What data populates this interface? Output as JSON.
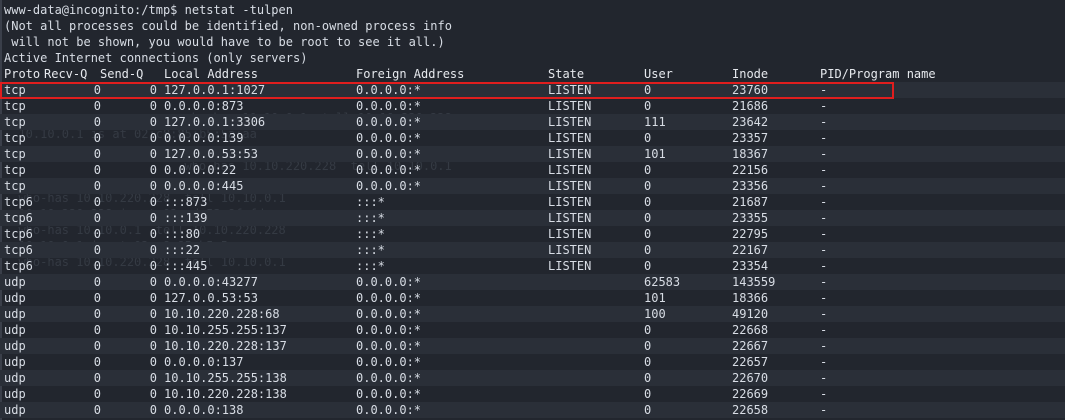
{
  "terminal": {
    "prompt": "www-data@incognito:/tmp$ netstat -tulpen",
    "notice_line1": "(Not all processes could be identified, non-owned process info",
    "notice_line2": " will not be shown, you would have to be root to see it all.)",
    "active_line": "Active Internet connections (only servers)"
  },
  "columns": {
    "proto": "Proto",
    "recvq": "Recv-Q",
    "sendq": "Send-Q",
    "local": "Local Address",
    "foreign": "Foreign Address",
    "state": "State",
    "user": "User",
    "inode": "Inode",
    "pid": "PID/Program name"
  },
  "rows": [
    {
      "proto": "tcp",
      "recvq": "0",
      "sendq": "0",
      "local": "127.0.0.1:1027",
      "foreign": "0.0.0.0:*",
      "state": "LISTEN",
      "user": "0",
      "inode": "23760",
      "pid": "-"
    },
    {
      "proto": "tcp",
      "recvq": "0",
      "sendq": "0",
      "local": "0.0.0.0:873",
      "foreign": "0.0.0.0:*",
      "state": "LISTEN",
      "user": "0",
      "inode": "21686",
      "pid": "-"
    },
    {
      "proto": "tcp",
      "recvq": "0",
      "sendq": "0",
      "local": "127.0.0.1:3306",
      "foreign": "0.0.0.0:*",
      "state": "LISTEN",
      "user": "111",
      "inode": "23642",
      "pid": "-"
    },
    {
      "proto": "tcp",
      "recvq": "0",
      "sendq": "0",
      "local": "0.0.0.0:139",
      "foreign": "0.0.0.0:*",
      "state": "LISTEN",
      "user": "0",
      "inode": "23357",
      "pid": "-"
    },
    {
      "proto": "tcp",
      "recvq": "0",
      "sendq": "0",
      "local": "127.0.0.53:53",
      "foreign": "0.0.0.0:*",
      "state": "LISTEN",
      "user": "101",
      "inode": "18367",
      "pid": "-"
    },
    {
      "proto": "tcp",
      "recvq": "0",
      "sendq": "0",
      "local": "0.0.0.0:22",
      "foreign": "0.0.0.0:*",
      "state": "LISTEN",
      "user": "0",
      "inode": "22156",
      "pid": "-"
    },
    {
      "proto": "tcp",
      "recvq": "0",
      "sendq": "0",
      "local": "0.0.0.0:445",
      "foreign": "0.0.0.0:*",
      "state": "LISTEN",
      "user": "0",
      "inode": "23356",
      "pid": "-"
    },
    {
      "proto": "tcp6",
      "recvq": "0",
      "sendq": "0",
      "local": ":::873",
      "foreign": ":::*",
      "state": "LISTEN",
      "user": "0",
      "inode": "21687",
      "pid": "-"
    },
    {
      "proto": "tcp6",
      "recvq": "0",
      "sendq": "0",
      "local": ":::139",
      "foreign": ":::*",
      "state": "LISTEN",
      "user": "0",
      "inode": "23355",
      "pid": "-"
    },
    {
      "proto": "tcp6",
      "recvq": "0",
      "sendq": "0",
      "local": ":::80",
      "foreign": ":::*",
      "state": "LISTEN",
      "user": "0",
      "inode": "22795",
      "pid": "-"
    },
    {
      "proto": "tcp6",
      "recvq": "0",
      "sendq": "0",
      "local": ":::22",
      "foreign": ":::*",
      "state": "LISTEN",
      "user": "0",
      "inode": "22167",
      "pid": "-"
    },
    {
      "proto": "tcp6",
      "recvq": "0",
      "sendq": "0",
      "local": ":::445",
      "foreign": ":::*",
      "state": "LISTEN",
      "user": "0",
      "inode": "23354",
      "pid": "-"
    },
    {
      "proto": "udp",
      "recvq": "0",
      "sendq": "0",
      "local": "0.0.0.0:43277",
      "foreign": "0.0.0.0:*",
      "state": "",
      "user": "62583",
      "inode": "143559",
      "pid": "-"
    },
    {
      "proto": "udp",
      "recvq": "0",
      "sendq": "0",
      "local": "127.0.0.53:53",
      "foreign": "0.0.0.0:*",
      "state": "",
      "user": "101",
      "inode": "18366",
      "pid": "-"
    },
    {
      "proto": "udp",
      "recvq": "0",
      "sendq": "0",
      "local": "10.10.220.228:68",
      "foreign": "0.0.0.0:*",
      "state": "",
      "user": "100",
      "inode": "49120",
      "pid": "-"
    },
    {
      "proto": "udp",
      "recvq": "0",
      "sendq": "0",
      "local": "10.10.255.255:137",
      "foreign": "0.0.0.0:*",
      "state": "",
      "user": "0",
      "inode": "22668",
      "pid": "-"
    },
    {
      "proto": "udp",
      "recvq": "0",
      "sendq": "0",
      "local": "10.10.220.228:137",
      "foreign": "0.0.0.0:*",
      "state": "",
      "user": "0",
      "inode": "22667",
      "pid": "-"
    },
    {
      "proto": "udp",
      "recvq": "0",
      "sendq": "0",
      "local": "0.0.0.0:137",
      "foreign": "0.0.0.0:*",
      "state": "",
      "user": "0",
      "inode": "22657",
      "pid": "-"
    },
    {
      "proto": "udp",
      "recvq": "0",
      "sendq": "0",
      "local": "10.10.255.255:138",
      "foreign": "0.0.0.0:*",
      "state": "",
      "user": "0",
      "inode": "22670",
      "pid": "-"
    },
    {
      "proto": "udp",
      "recvq": "0",
      "sendq": "0",
      "local": "10.10.220.228:138",
      "foreign": "0.0.0.0:*",
      "state": "",
      "user": "0",
      "inode": "22669",
      "pid": "-"
    },
    {
      "proto": "udp",
      "recvq": "0",
      "sendq": "0",
      "local": "0.0.0.0:138",
      "foreign": "0.0.0.0:*",
      "state": "",
      "user": "0",
      "inode": "22658",
      "pid": "-"
    }
  ],
  "colors": {
    "background": "#22262e",
    "text": "#d8dde5",
    "highlight_border": "#e01e1e"
  }
}
